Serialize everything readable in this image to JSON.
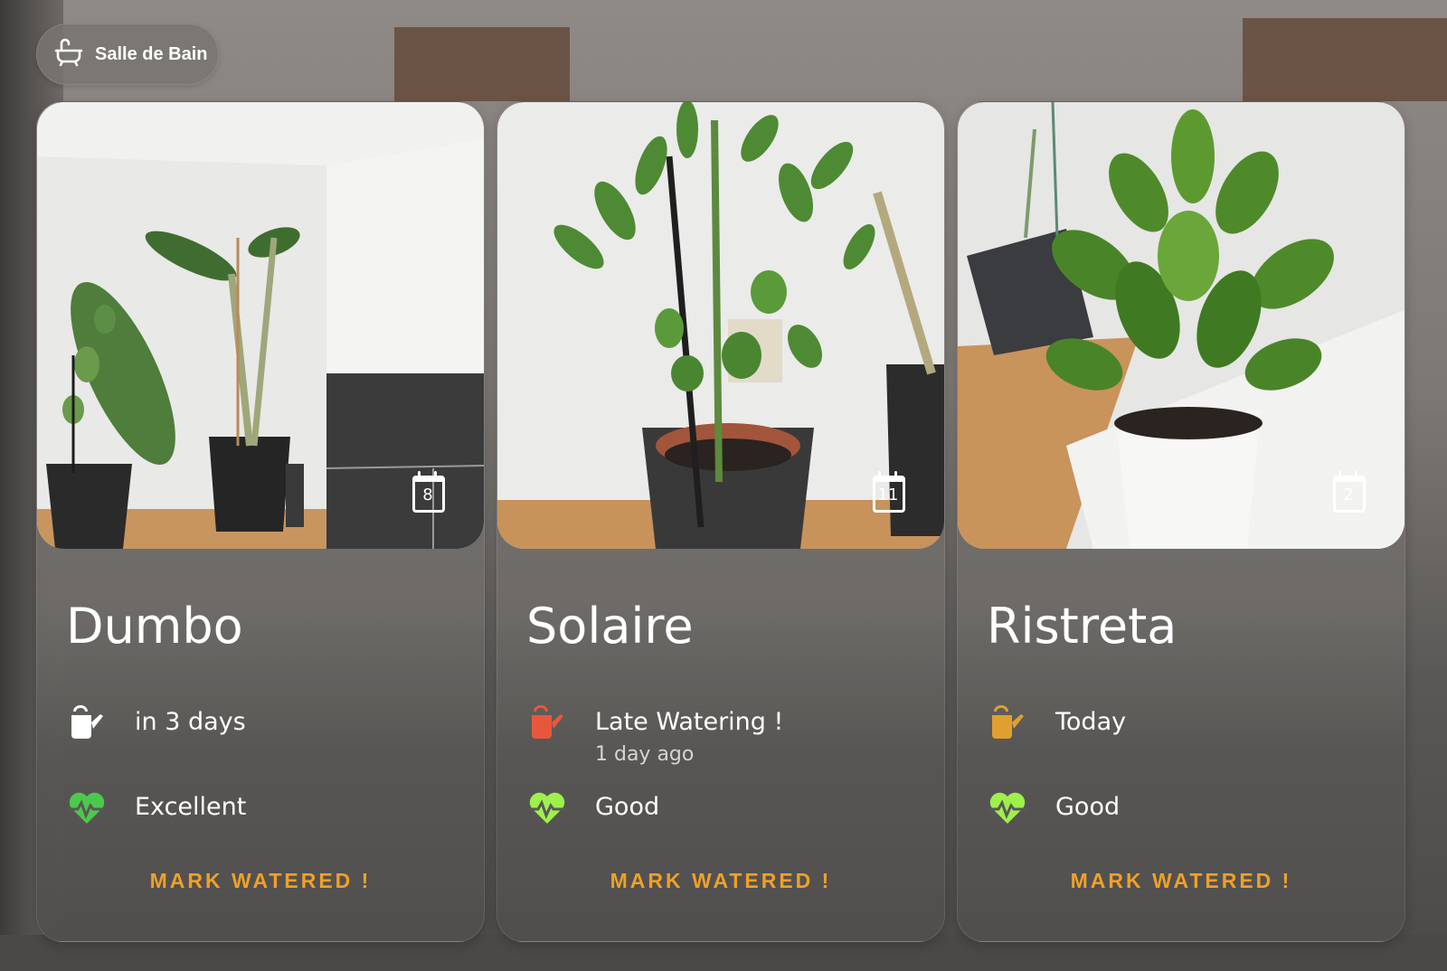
{
  "room": {
    "name": "Salle de Bain",
    "icon": "bathtub-icon"
  },
  "actions": {
    "mark_watered_label": "MARK WATERED !"
  },
  "colors": {
    "accent": "#f0a028",
    "water_ok": "#ffffff",
    "water_late": "#e8573c",
    "water_today": "#e0a030",
    "health_excellent": "#4cc94c",
    "health_good": "#9ef04a"
  },
  "plants": [
    {
      "name": "Dumbo",
      "calendar_day": "8",
      "watering": {
        "text": "in 3 days",
        "sub": "",
        "status": "ok",
        "icon": "watering-can-icon"
      },
      "health": {
        "text": "Excellent",
        "status": "excellent",
        "icon": "heart-pulse-icon"
      }
    },
    {
      "name": "Solaire",
      "calendar_day": "11",
      "watering": {
        "text": "Late Watering !",
        "sub": "1 day ago",
        "status": "late",
        "icon": "watering-can-icon"
      },
      "health": {
        "text": "Good",
        "status": "good",
        "icon": "heart-pulse-icon"
      }
    },
    {
      "name": "Ristreta",
      "calendar_day": "2",
      "watering": {
        "text": "Today",
        "sub": "",
        "status": "today",
        "icon": "watering-can-icon"
      },
      "health": {
        "text": "Good",
        "status": "good",
        "icon": "heart-pulse-icon"
      }
    }
  ]
}
